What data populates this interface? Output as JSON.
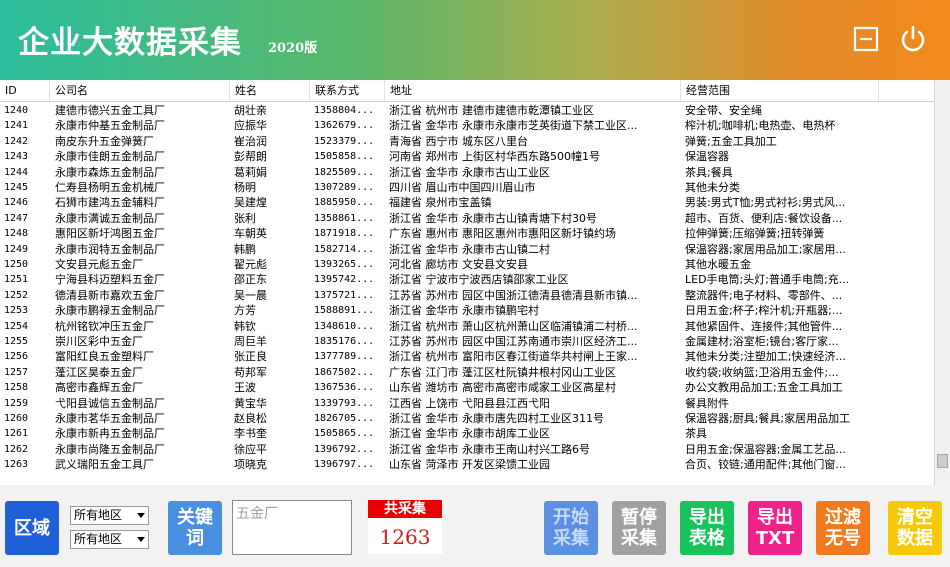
{
  "header": {
    "title": "企业大数据采集",
    "version": "2020版",
    "colors": {
      "gradient_start": "#2bbd9b",
      "gradient_end": "#f28a1c"
    },
    "icons": [
      "minimize-icon",
      "power-icon"
    ]
  },
  "table": {
    "columns": [
      "ID",
      "公司名",
      "姓名",
      "联系方式",
      "地址",
      "经营范围"
    ],
    "rows": [
      [
        "1240",
        "建德市德兴五金工具厂",
        "胡壮亲",
        "1358804...",
        "浙江省  杭州市  建德市建德市乾潭镇工业区",
        "安全带、安全绳"
      ],
      [
        "1241",
        "永康市仲基五金制品厂",
        "应振华",
        "1362679...",
        "浙江省  金华市  永康市永康市芝英街道下禁工业区...",
        "榨汁机;咖啡机;电热壶、电热杯"
      ],
      [
        "1242",
        "南皮东升五金弹簧厂",
        "崔治润",
        "1523379...",
        "青海省  西宁市  城东区八里台",
        "弹簧;五金工具加工"
      ],
      [
        "1243",
        "永康市佳朗五金制品厂",
        "彭帮朗",
        "1505858...",
        "河南省  郑州市  上街区村华西东路500幢1号",
        "保温容器"
      ],
      [
        "1244",
        "永康市森炼五金制品厂",
        "葛莉娟",
        "1825509...",
        "浙江省  金华市  永康市古山工业区",
        "茶具;餐具"
      ],
      [
        "1245",
        "仁寿县杨明五金机械厂",
        "杨明",
        "1307289...",
        "四川省  眉山市中国四川眉山市",
        "其他未分类"
      ],
      [
        "1246",
        "石狮市建鸿五金辅料厂",
        "吴建煌",
        "1885950...",
        "福建省  泉州市宝盖镇",
        "男装:男式T恤;男式衬衫;男式风..."
      ],
      [
        "1247",
        "永康市满诚五金制品厂",
        "张利",
        "1358861...",
        "浙江省  金华市  永康市古山镇青塘下村30号",
        "超市、百货、便利店:餐饮设备..."
      ],
      [
        "1248",
        "惠阳区新圩鸿图五金厂",
        "车朝英",
        "1871918...",
        "广东省  惠州市  惠阳区惠州市惠阳区新圩镇约场",
        "拉伸弹簧;压缩弹簧;扭转弹簧"
      ],
      [
        "1249",
        "永康市润特五金制品厂",
        "韩鹏",
        "1582714...",
        "浙江省  金华市  永康市古山镇二村",
        "保温容器;家居用品加工;家居用..."
      ],
      [
        "1250",
        "文安县元彪五金厂",
        "翟元彪",
        "1393265...",
        "河北省  廊坊市  文安县文安县",
        "其他水暖五金"
      ],
      [
        "1251",
        "宁海县科迈塑料五金厂",
        "邵正东",
        "1395742...",
        "浙江省  宁波市宁波西店镇邵家工业区",
        "LED手电筒;头灯;普通手电筒;充..."
      ],
      [
        "1252",
        "德清县新市嘉欢五金厂",
        "吴一晨",
        "1375721...",
        "江苏省  苏州市  园区中国浙江德清县德清县新市镇...",
        "整流器件;电子材料、零部件、..."
      ],
      [
        "1253",
        "永康市鹏禄五金制品厂",
        "方芳",
        "1588891...",
        "浙江省  金华市  永康市镇鹏宅村",
        "日用五金;杯子;榨汁机;开瓶器;..."
      ],
      [
        "1254",
        "杭州铭钦冲压五金厂",
        "韩钦",
        "1348610...",
        "浙江省  杭州市  萧山区杭州萧山区临浦镇浦二村桥...",
        "其他紧固件、连接件;其他管件..."
      ],
      [
        "1255",
        "崇川区彩中五金厂",
        "周巨羊",
        "1835176...",
        "江苏省  苏州市  园区中国江苏南通市崇川区经济工...",
        "金属建材;浴室柜;镜台;客厅家..."
      ],
      [
        "1256",
        "富阳红良五金塑料厂",
        "张正良",
        "1377789...",
        "浙江省  杭州市  富阳市区春江街道华共村闸上王家...",
        "其他未分类;注塑加工;快速经济..."
      ],
      [
        "1257",
        "蓬江区昊泰五金厂",
        "苟邦军",
        "1867502...",
        "广东省  江门市  蓬江区杜阮镇井根村冈山工业区",
        "收约袋;收纳篮;卫浴用五金件;..."
      ],
      [
        "1258",
        "高密市鑫辉五金厂",
        "王波",
        "1367536...",
        "山东省  潍坊市  高密市高密市咸家工业区高星村",
        "办公文教用品加工;五金工具加工"
      ],
      [
        "1259",
        "弋阳县诚信五金制品厂",
        "黄宝华",
        "1339793...",
        "江西省  上饶市  弋阳县县江西弋阳",
        "餐具附件"
      ],
      [
        "1260",
        "永康市茗华五金制品厂",
        "赵良松",
        "1826705...",
        "浙江省  金华市  永康市唐先四村工业区311号",
        "保温容器;厨具;餐具;家居用品加工"
      ],
      [
        "1261",
        "永康市新冉五金制品厂",
        "李书奎",
        "1505865...",
        "浙江省  金华市  永康市胡库工业区",
        "茶具"
      ],
      [
        "1262",
        "永康市尚隆五金制品厂",
        "徐应平",
        "1396792...",
        "浙江省  金华市  永康市王南山村兴工路6号",
        "日用五金;保温容器;金属工艺品..."
      ],
      [
        "1263",
        "武义瑞阳五金工具厂",
        "项晓克",
        "1396797...",
        "山东省  菏泽市  开发区梁馈工业园",
        "合页、铰链;通用配件;其他门窗..."
      ]
    ]
  },
  "toolbar": {
    "region_label": "区域",
    "region_select_1": "所有地区",
    "region_select_2": "所有地区",
    "keyword_label": "关键词",
    "keyword_value": "五金厂",
    "count_label": "共采集",
    "count_value": "1263",
    "start_label": "开始采集",
    "pause_label": "暂停采集",
    "export_table_label": "导出表格",
    "export_txt_label": "导出TXT",
    "filter_label": "过滤无号",
    "clear_label": "清空数据",
    "colors": {
      "region": "#1f5fd8",
      "keyword": "#4a8fe0",
      "start": "#5b8fe0",
      "pause": "#a0a0a0",
      "export_table": "#17c35a",
      "export_txt": "#f0228a",
      "filter": "#f27a1e",
      "clear": "#f8c80a"
    }
  }
}
